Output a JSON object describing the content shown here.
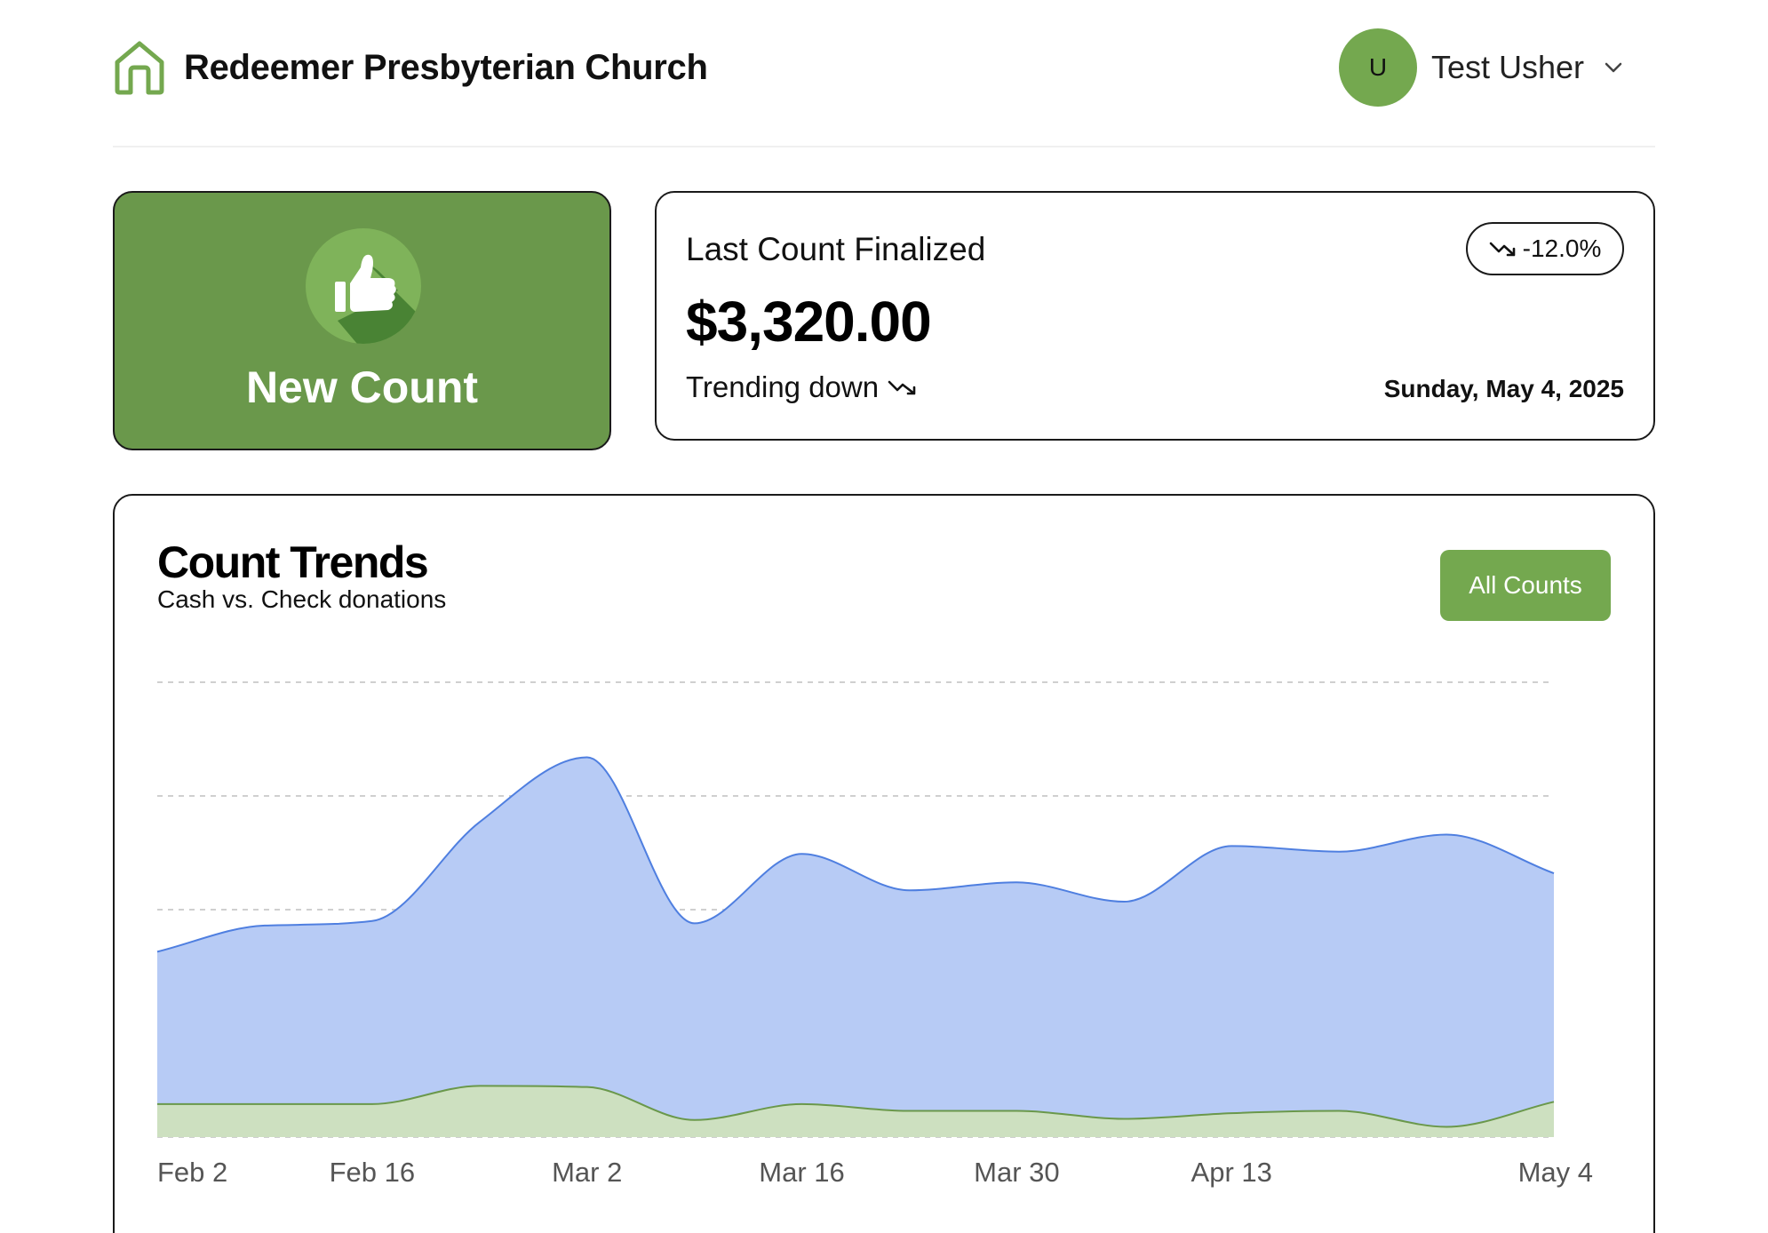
{
  "header": {
    "church_name": "Redeemer Presbyterian Church",
    "brand_icon": "home-icon",
    "user_initial": "U",
    "user_name": "Test Usher",
    "user_menu_icon": "chevron-down-icon"
  },
  "new_count": {
    "label": "New Count",
    "icon": "thumbs-up-icon"
  },
  "last_count": {
    "title": "Last Count Finalized",
    "change_badge": "-12.0%",
    "amount": "$3,320.00",
    "trend_text": "Trending down",
    "date": "Sunday, May 4, 2025"
  },
  "trends": {
    "title": "Count Trends",
    "subtitle": "Cash vs. Check donations",
    "all_counts_label": "All Counts"
  },
  "colors": {
    "brand_green": "#6a984b",
    "button_green": "#74a84f",
    "check_fill": "#b7cbf5",
    "check_line": "#4f7fe0",
    "cash_fill": "#cde0c0",
    "cash_line": "#6a984b"
  },
  "chart_data": {
    "type": "area",
    "x": [
      "2025-02-02",
      "2025-02-09",
      "2025-02-16",
      "2025-02-23",
      "2025-03-02",
      "2025-03-09",
      "2025-03-16",
      "2025-03-23",
      "2025-03-30",
      "2025-04-06",
      "2025-04-13",
      "2025-04-20",
      "2025-04-27",
      "2025-05-04"
    ],
    "x_tick_labels": [
      "Feb 2",
      "Feb 16",
      "Mar 2",
      "Mar 16",
      "Mar 30",
      "Apr 13",
      "May 4"
    ],
    "stacked": true,
    "series": [
      {
        "values": [
          290,
          290,
          290,
          450,
          440,
          150,
          290,
          230,
          230,
          160,
          210,
          230,
          90,
          310
        ]
      },
      {
        "values": [
          1340,
          1570,
          1610,
          2320,
          2900,
          1730,
          2200,
          1940,
          2010,
          1910,
          2350,
          2280,
          2570,
          2010
        ]
      }
    ],
    "ylim": [
      0,
      4000
    ],
    "grid": true,
    "legend": "none"
  }
}
